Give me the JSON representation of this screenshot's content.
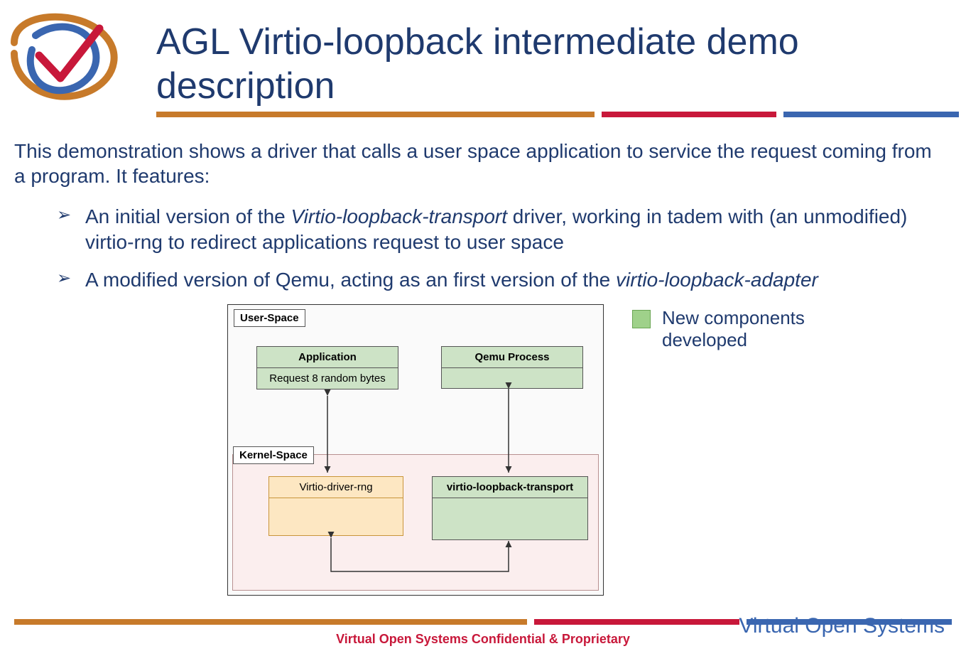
{
  "title": "AGL Virtio-loopback intermediate demo description",
  "intro": "This demonstration shows a driver that calls a user space application to service the request coming from a program. It features:",
  "bullets": [
    {
      "pre": "An initial version of the ",
      "em": "Virtio-loopback-transport",
      "post": " driver, working in tadem with (an unmodified) virtio-rng to redirect applications request to user space"
    },
    {
      "pre": "A modified version of Qemu, acting as an first version of the ",
      "em": "virtio-loopback-adapter",
      "post": ""
    }
  ],
  "diagram": {
    "user_space_label": "User-Space",
    "kernel_space_label": "Kernel-Space",
    "app_box_title": "Application",
    "app_box_sub": "Request 8 random bytes",
    "qemu_box_title": "Qemu Process",
    "rng_box_title": "Virtio-driver-rng",
    "vlt_box_title": "virtio-loopback-transport"
  },
  "legend_text": "New components developed",
  "footer_text": "Virtual Open Systems Confidential & Proprietary",
  "brand_text": "Virtual Open Systems"
}
